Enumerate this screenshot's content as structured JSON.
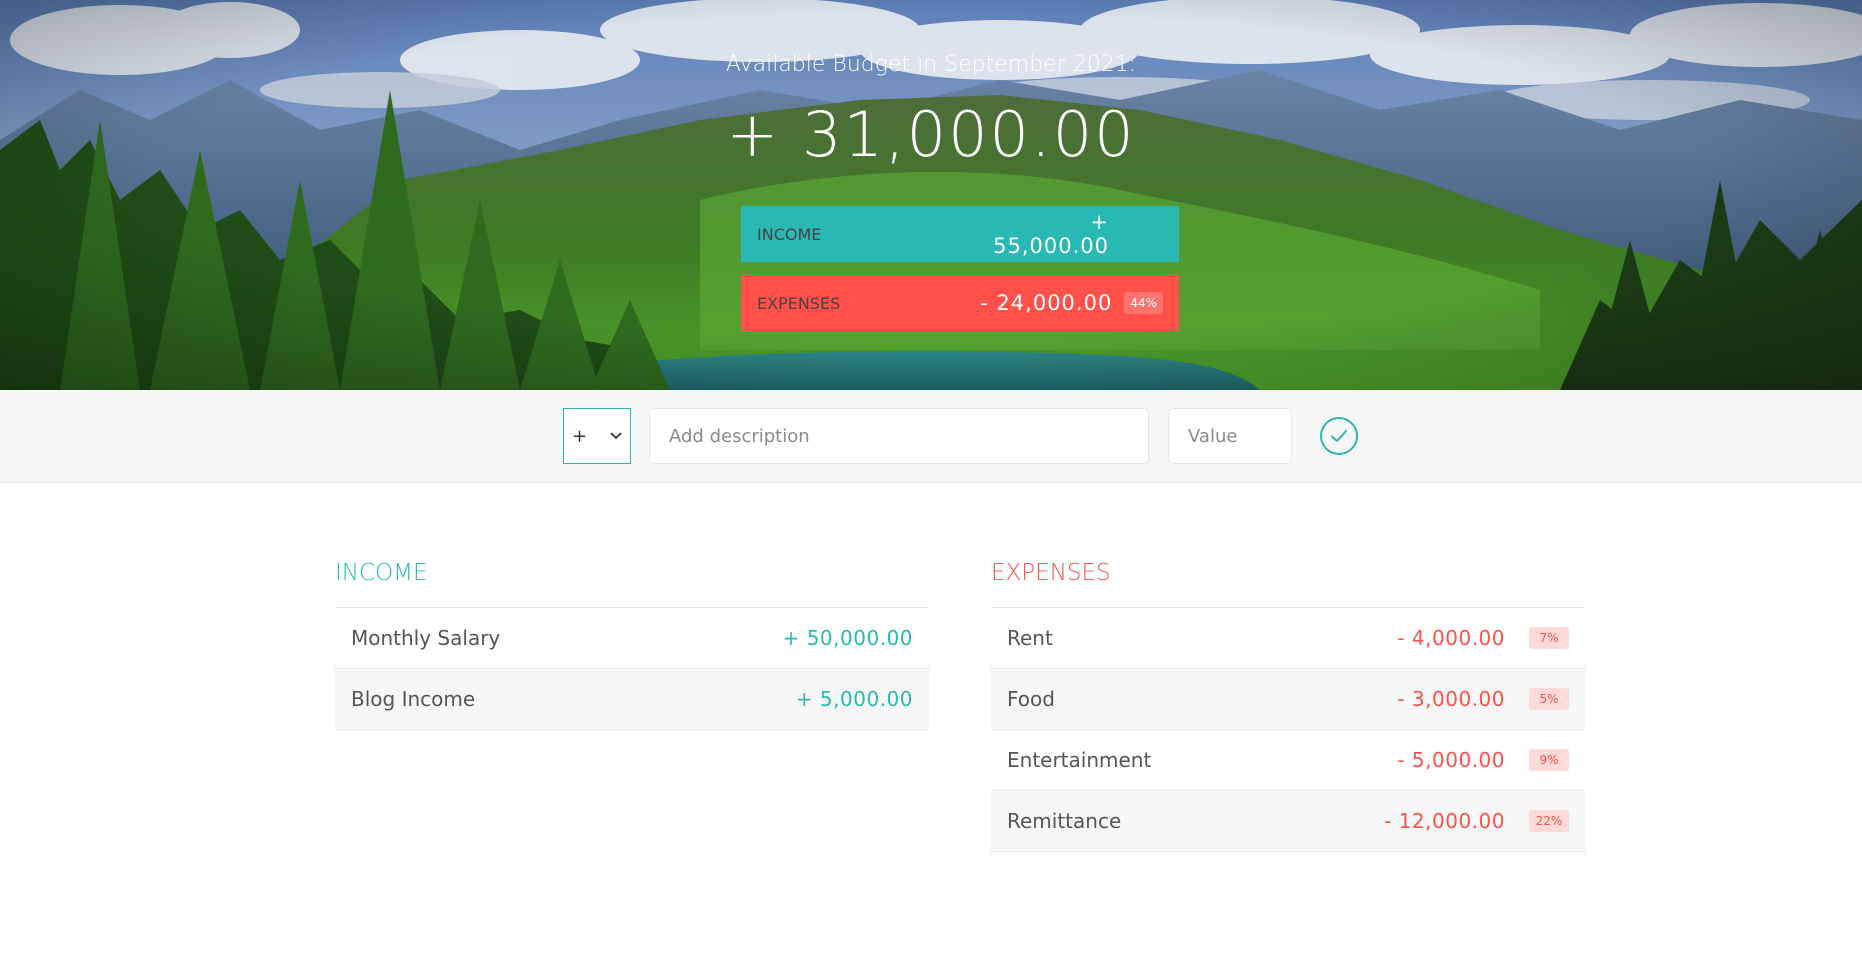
{
  "budget": {
    "title": "Available Budget in September 2021:",
    "value": "+ 31,000.00"
  },
  "summary": {
    "income": {
      "label": "Income",
      "value": "+ 55,000.00",
      "color": "#28b9b5"
    },
    "expenses": {
      "label": "Expenses",
      "value": "- 24,000.00",
      "percentage": "44%",
      "color": "#ff5049"
    }
  },
  "add": {
    "type_selected": "+",
    "description_placeholder": "Add description",
    "value_placeholder": "Value",
    "submit_icon": "check-circle-icon"
  },
  "income": {
    "title": "Income",
    "items": [
      {
        "description": "Monthly Salary",
        "value": "+ 50,000.00"
      },
      {
        "description": "Blog Income",
        "value": "+ 5,000.00"
      }
    ]
  },
  "expenses": {
    "title": "Expenses",
    "items": [
      {
        "description": "Rent",
        "value": "- 4,000.00",
        "percentage": "7%"
      },
      {
        "description": "Food",
        "value": "- 3,000.00",
        "percentage": "5%"
      },
      {
        "description": "Entertainment",
        "value": "- 5,000.00",
        "percentage": "9%"
      },
      {
        "description": "Remittance",
        "value": "- 12,000.00",
        "percentage": "22%"
      }
    ]
  }
}
